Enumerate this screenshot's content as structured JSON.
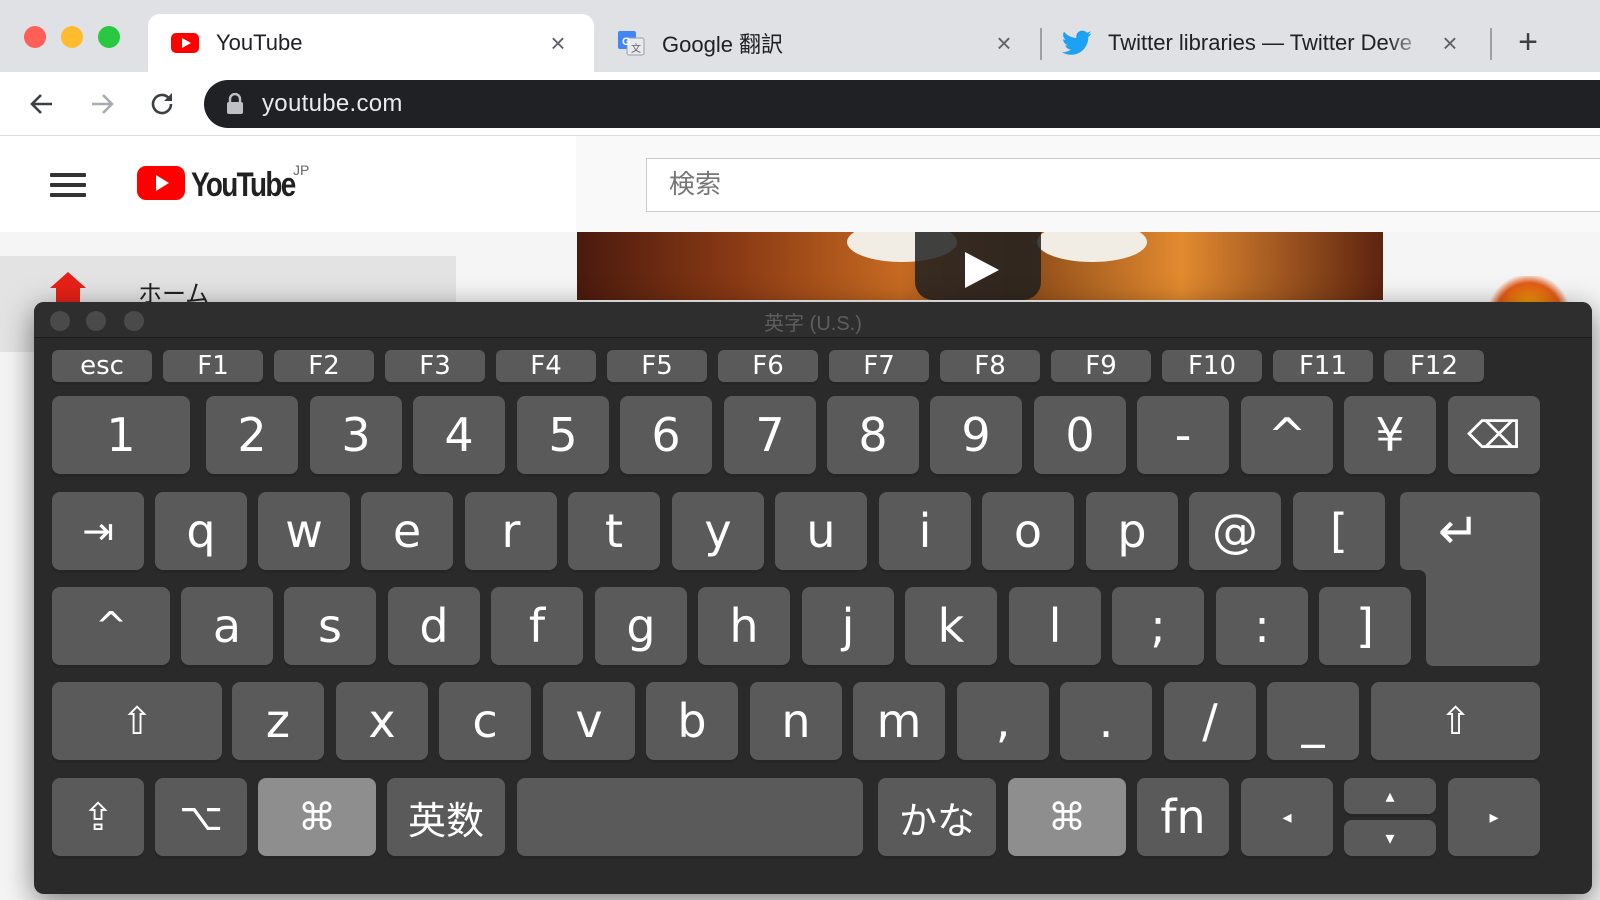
{
  "browser": {
    "tabs": [
      {
        "title": "YouTube",
        "close": "×",
        "favicon": "youtube-icon"
      },
      {
        "title": "Google 翻訳",
        "close": "×",
        "favicon": "google-translate-icon"
      },
      {
        "title": "Twitter libraries — Twitter Deve",
        "close": "×",
        "favicon": "twitter-bird-icon"
      }
    ],
    "new_tab": "+",
    "address": "youtube.com"
  },
  "youtube": {
    "logo_text": "YouTube",
    "region": "JP",
    "search_placeholder": "検索",
    "sidebar_home": "ホーム"
  },
  "keyboard": {
    "title": "英字 (U.S.)",
    "function_row": [
      "esc",
      "F1",
      "F2",
      "F3",
      "F4",
      "F5",
      "F6",
      "F7",
      "F8",
      "F9",
      "F10",
      "F11",
      "F12"
    ],
    "number_row": [
      "1",
      "2",
      "3",
      "4",
      "5",
      "6",
      "7",
      "8",
      "9",
      "0",
      "-",
      "^",
      "¥",
      "⌫"
    ],
    "q_row": [
      "⇥",
      "q",
      "w",
      "e",
      "r",
      "t",
      "y",
      "u",
      "i",
      "o",
      "p",
      "@",
      "["
    ],
    "a_row": [
      "^",
      "a",
      "s",
      "d",
      "f",
      "g",
      "h",
      "j",
      "k",
      "l",
      ";",
      ":",
      "]"
    ],
    "z_row": [
      "⇧",
      "z",
      "x",
      "c",
      "v",
      "b",
      "n",
      "m",
      ",",
      ".",
      "/",
      "_",
      "⇧"
    ],
    "bottom_row": [
      "⇪",
      "⌥",
      "⌘",
      "英数",
      "",
      "かな",
      "⌘",
      "fn",
      "◂",
      "▴",
      "▾",
      "▸"
    ],
    "return": "↵"
  },
  "colors": {
    "key": "#5a5a5a",
    "key_pressed": "#8e8e8e",
    "keyboard_bg": "#2a2a2a",
    "youtube_red": "#ff0000",
    "twitter_blue": "#1da1f2"
  }
}
